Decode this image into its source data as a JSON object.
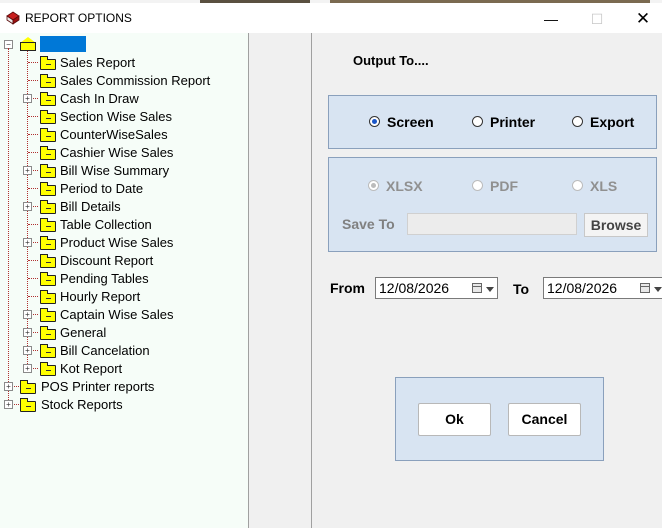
{
  "window": {
    "title": "REPORT OPTIONS",
    "minimize": "—",
    "maximize": "☐",
    "close": "✕"
  },
  "tree": {
    "root_label": "",
    "children": [
      {
        "label": "Sales Report",
        "expandable": false
      },
      {
        "label": "Sales Commission Report",
        "expandable": false
      },
      {
        "label": "Cash In Draw",
        "expandable": true
      },
      {
        "label": "Section Wise Sales",
        "expandable": false
      },
      {
        "label": "CounterWiseSales",
        "expandable": false
      },
      {
        "label": "Cashier Wise Sales",
        "expandable": false
      },
      {
        "label": "Bill Wise Summary",
        "expandable": true
      },
      {
        "label": "Period to Date",
        "expandable": false
      },
      {
        "label": "Bill Details",
        "expandable": true
      },
      {
        "label": "Table Collection",
        "expandable": false
      },
      {
        "label": "Product Wise Sales",
        "expandable": true
      },
      {
        "label": "Discount Report",
        "expandable": false
      },
      {
        "label": "Pending Tables",
        "expandable": false
      },
      {
        "label": "Hourly Report",
        "expandable": false
      },
      {
        "label": "Captain Wise Sales",
        "expandable": true
      },
      {
        "label": "General",
        "expandable": true
      },
      {
        "label": "Bill Cancelation",
        "expandable": true
      },
      {
        "label": "Kot Report",
        "expandable": true
      }
    ],
    "top_level": [
      {
        "label": "POS Printer reports",
        "expandable": true
      },
      {
        "label": "Stock Reports",
        "expandable": true
      }
    ]
  },
  "output": {
    "title": "Output To....",
    "options": [
      {
        "label": "Screen",
        "checked": true
      },
      {
        "label": "Printer",
        "checked": false
      },
      {
        "label": "Export",
        "checked": false
      }
    ]
  },
  "export": {
    "formats": [
      {
        "label": "XLSX",
        "checked": true
      },
      {
        "label": "PDF",
        "checked": false
      },
      {
        "label": "XLS",
        "checked": false
      }
    ],
    "save_to_label": "Save To",
    "save_to_value": "",
    "browse_label": "Browse"
  },
  "dates": {
    "from_label": "From",
    "from_value": "12/08/2026",
    "to_label": "To",
    "to_value": "12/08/2026"
  },
  "actions": {
    "ok_label": "Ok",
    "cancel_label": "Cancel"
  },
  "colors": {
    "selection": "#0078d7",
    "group_bg": "#d8e4f2",
    "tree_bg": "#f6fdf8",
    "folder": "#ffff00"
  }
}
